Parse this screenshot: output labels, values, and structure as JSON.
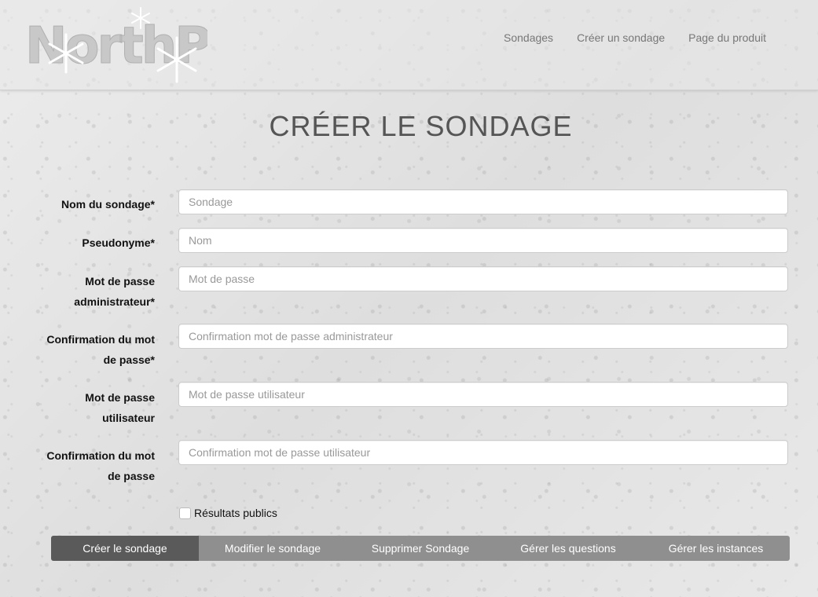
{
  "header": {
    "logo_text": "NorthPoll",
    "nav": [
      {
        "label": "Sondages"
      },
      {
        "label": "Créer un sondage"
      },
      {
        "label": "Page du produit"
      }
    ]
  },
  "page": {
    "title": "CRÉER LE SONDAGE"
  },
  "form": {
    "fields": [
      {
        "label": "Nom du sondage*",
        "placeholder": "Sondage",
        "value": ""
      },
      {
        "label": "Pseudonyme*",
        "placeholder": "Nom",
        "value": ""
      },
      {
        "label": "Mot de passe administrateur*",
        "placeholder": "Mot de passe",
        "value": ""
      },
      {
        "label": "Confirmation du mot de passe*",
        "placeholder": "Confirmation mot de passe administrateur",
        "value": ""
      },
      {
        "label": "Mot de passe utilisateur",
        "placeholder": "Mot de passe utilisateur",
        "value": ""
      },
      {
        "label": "Confirmation du mot de passe",
        "placeholder": "Confirmation mot de passe utilisateur",
        "value": ""
      }
    ],
    "public_results_label": "Résultats publics",
    "public_results_checked": false
  },
  "actions": [
    {
      "label": "Créer le sondage",
      "active": true
    },
    {
      "label": "Modifier le sondage",
      "active": false
    },
    {
      "label": "Supprimer Sondage",
      "active": false
    },
    {
      "label": "Gérer les questions",
      "active": false
    },
    {
      "label": "Gérer les instances",
      "active": false
    }
  ],
  "colors": {
    "active_button": "#5a5a5a",
    "button": "#8f8f8f",
    "nav_text": "#777777"
  }
}
